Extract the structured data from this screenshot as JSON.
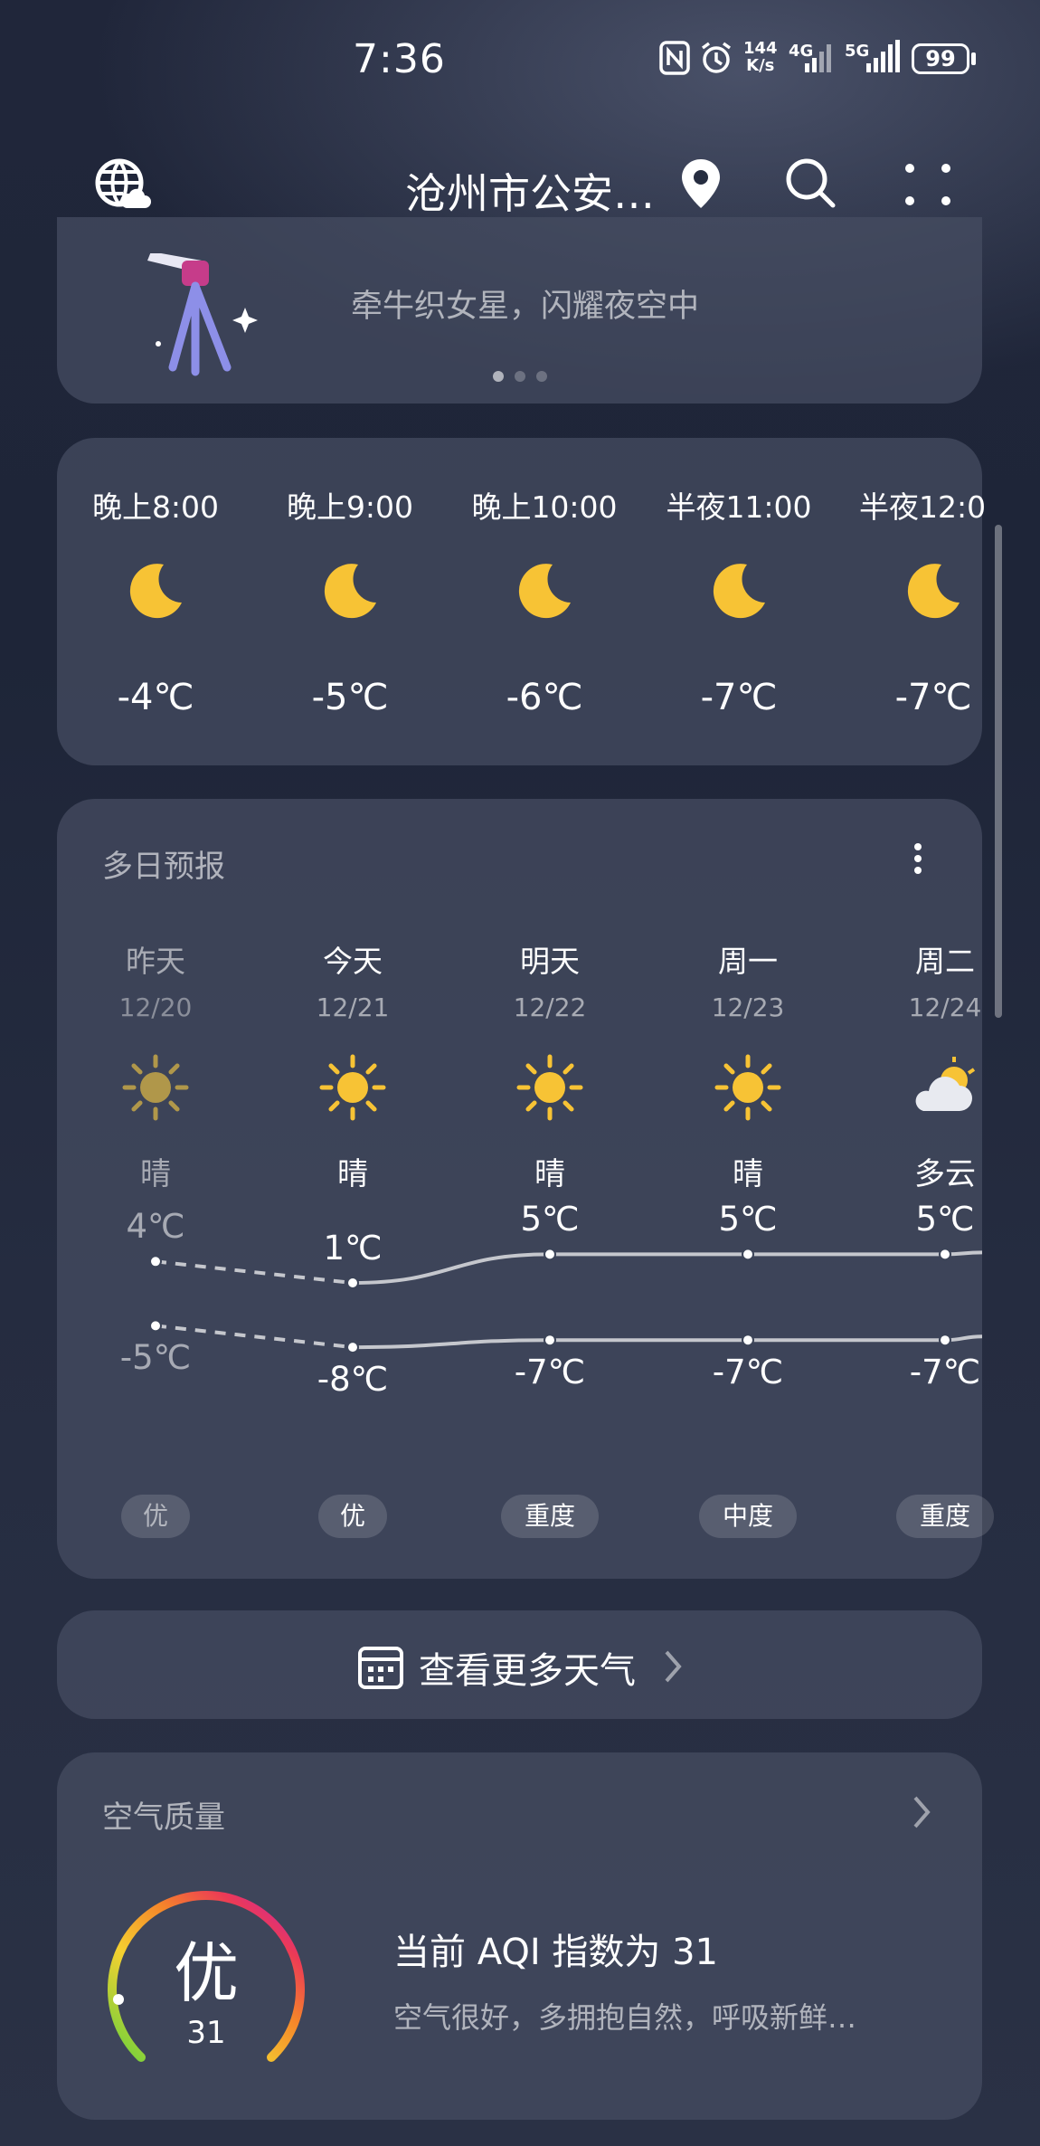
{
  "status_bar": {
    "time": "7:36",
    "speed_top": "144",
    "speed_unit": "K/s",
    "net1": "4G",
    "net2": "5G",
    "battery": "99"
  },
  "header": {
    "city": "沧州市公安…",
    "globe_icon": "globe-cloud-icon",
    "location_icon": "location-pin-icon",
    "search_icon": "search-icon",
    "menu_icon": "more-dots-icon"
  },
  "banner": {
    "subtitle": "牵牛织女星，闪耀夜空中",
    "illustration": "telescope-icon"
  },
  "hourly": [
    {
      "label": "晚上8:00",
      "temp": "-4℃",
      "icon": "moon-icon"
    },
    {
      "label": "晚上9:00",
      "temp": "-5℃",
      "icon": "moon-icon"
    },
    {
      "label": "晚上10:00",
      "temp": "-6℃",
      "icon": "moon-icon"
    },
    {
      "label": "半夜11:00",
      "temp": "-7℃",
      "icon": "moon-icon"
    },
    {
      "label": "半夜12:0",
      "temp": "-7℃",
      "icon": "moon-icon"
    }
  ],
  "forecast": {
    "title": "多日预报",
    "days": [
      {
        "name": "昨天",
        "date": "12/20",
        "cond": "晴",
        "high": "4℃",
        "low": "-5℃",
        "aqi": "优",
        "icon": "sun-icon"
      },
      {
        "name": "今天",
        "date": "12/21",
        "cond": "晴",
        "high": "1℃",
        "low": "-8℃",
        "aqi": "优",
        "icon": "sun-icon"
      },
      {
        "name": "明天",
        "date": "12/22",
        "cond": "晴",
        "high": "5℃",
        "low": "-7℃",
        "aqi": "重度",
        "icon": "sun-icon"
      },
      {
        "name": "周一",
        "date": "12/23",
        "cond": "晴",
        "high": "5℃",
        "low": "-7℃",
        "aqi": "中度",
        "icon": "sun-icon"
      },
      {
        "name": "周二",
        "date": "12/24",
        "cond": "多云",
        "high": "5℃",
        "low": "-7℃",
        "aqi": "重度",
        "icon": "partly-cloudy-icon"
      }
    ]
  },
  "more_weather": {
    "label": "查看更多天气"
  },
  "air_quality": {
    "title": "空气质量",
    "level": "优",
    "value": "31",
    "headline": "当前 AQI 指数为 31",
    "desc": "空气很好，多拥抱自然，呼吸新鲜…"
  }
}
